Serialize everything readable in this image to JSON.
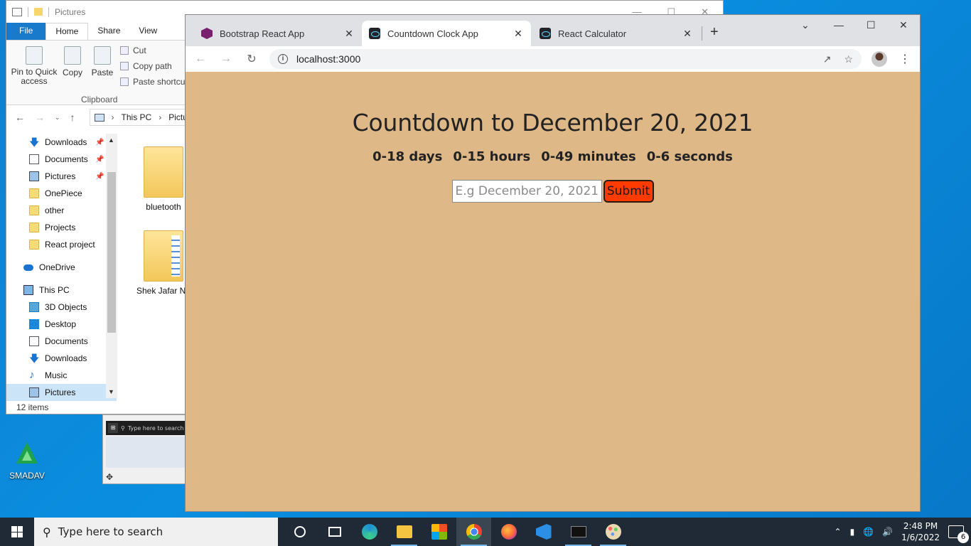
{
  "desktop": {
    "icon_label": "SMADAV"
  },
  "explorer": {
    "title": "Pictures",
    "ribbon_tabs": [
      "File",
      "Home",
      "Share",
      "View"
    ],
    "ribbon": {
      "pin_label": "Pin to Quick access",
      "copy_label": "Copy",
      "paste_label": "Paste",
      "cut_label": "Cut",
      "copy_path_label": "Copy path",
      "paste_shortcut_label": "Paste shortcut",
      "group_label": "Clipboard"
    },
    "path": [
      "This PC",
      "Pictures"
    ],
    "nav_items": [
      {
        "label": "Downloads",
        "icon": "download-icon",
        "pinned": true
      },
      {
        "label": "Documents",
        "icon": "documents-icon",
        "pinned": true
      },
      {
        "label": "Pictures",
        "icon": "pictures-icon",
        "pinned": true
      },
      {
        "label": "OnePiece",
        "icon": "folder-icon"
      },
      {
        "label": "other",
        "icon": "folder-icon"
      },
      {
        "label": "Projects",
        "icon": "folder-icon"
      },
      {
        "label": "React project",
        "icon": "folder-icon"
      },
      {
        "label": "OneDrive",
        "icon": "onedrive-icon"
      },
      {
        "label": "This PC",
        "icon": "this-pc-icon"
      },
      {
        "label": "3D Objects",
        "icon": "3d-objects-icon"
      },
      {
        "label": "Desktop",
        "icon": "desktop-icon"
      },
      {
        "label": "Documents",
        "icon": "documents-icon"
      },
      {
        "label": "Downloads",
        "icon": "download-icon"
      },
      {
        "label": "Music",
        "icon": "music-icon"
      },
      {
        "label": "Pictures",
        "icon": "pictures-icon"
      }
    ],
    "files": [
      "bluetooth",
      "Shek Jafar Ne"
    ],
    "status": "12 items"
  },
  "thumbnail": {
    "search_text": "Type here to search"
  },
  "browser": {
    "tabs": [
      {
        "title": "Bootstrap React App",
        "favicon": "bootstrap-icon"
      },
      {
        "title": "Countdown Clock App",
        "favicon": "react-icon",
        "active": true
      },
      {
        "title": "React Calculator",
        "favicon": "react-icon"
      }
    ],
    "url": "localhost:3000",
    "page": {
      "heading": "Countdown to December 20, 2021",
      "counts": [
        "0-18 days",
        "0-15 hours",
        "0-49 minutes",
        "0-6 seconds"
      ],
      "input_placeholder": "E.g December 20, 2021",
      "submit_label": "Submit",
      "background": "#deb887",
      "button_color": "#ff3b00"
    }
  },
  "taskbar": {
    "search_placeholder": "Type here to search",
    "time": "2:48 PM",
    "date": "1/6/2022",
    "notification_count": "6"
  }
}
